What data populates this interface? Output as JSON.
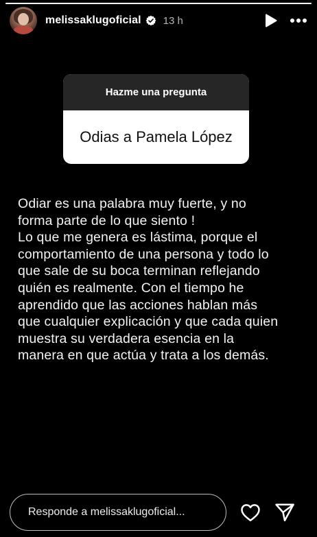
{
  "story": {
    "progress": 1.0
  },
  "header": {
    "username": "melissaklugoficial",
    "time": "13 h",
    "avatar_icon": "profile-avatar",
    "verified_icon": "verified-badge-icon",
    "play_icon": "play-icon",
    "more_icon": "more-options-icon"
  },
  "sticker": {
    "title": "Hazme una pregunta",
    "question": "Odias a Pamela López"
  },
  "answer": {
    "text": "Odiar es una palabra muy fuerte, y no\nforma parte de lo que siento !\nLo que me genera es lástima, porque el\ncomportamiento de una persona y todo lo\nque sale de su boca terminan reflejando\nquién es realmente. Con el tiempo he\naprendido que las acciones hablan más\nque cualquier explicación y que cada quien\nmuestra su verdadera esencia en la\nmanera en que actúa y trata a los demás."
  },
  "footer": {
    "reply_placeholder": "Responde a melissaklugoficial...",
    "like_icon": "heart-icon",
    "share_icon": "send-icon"
  },
  "colors": {
    "background": "#000000",
    "sticker_header": "#262626",
    "sticker_body": "#ffffff",
    "verified_blue": "#ffffff"
  }
}
